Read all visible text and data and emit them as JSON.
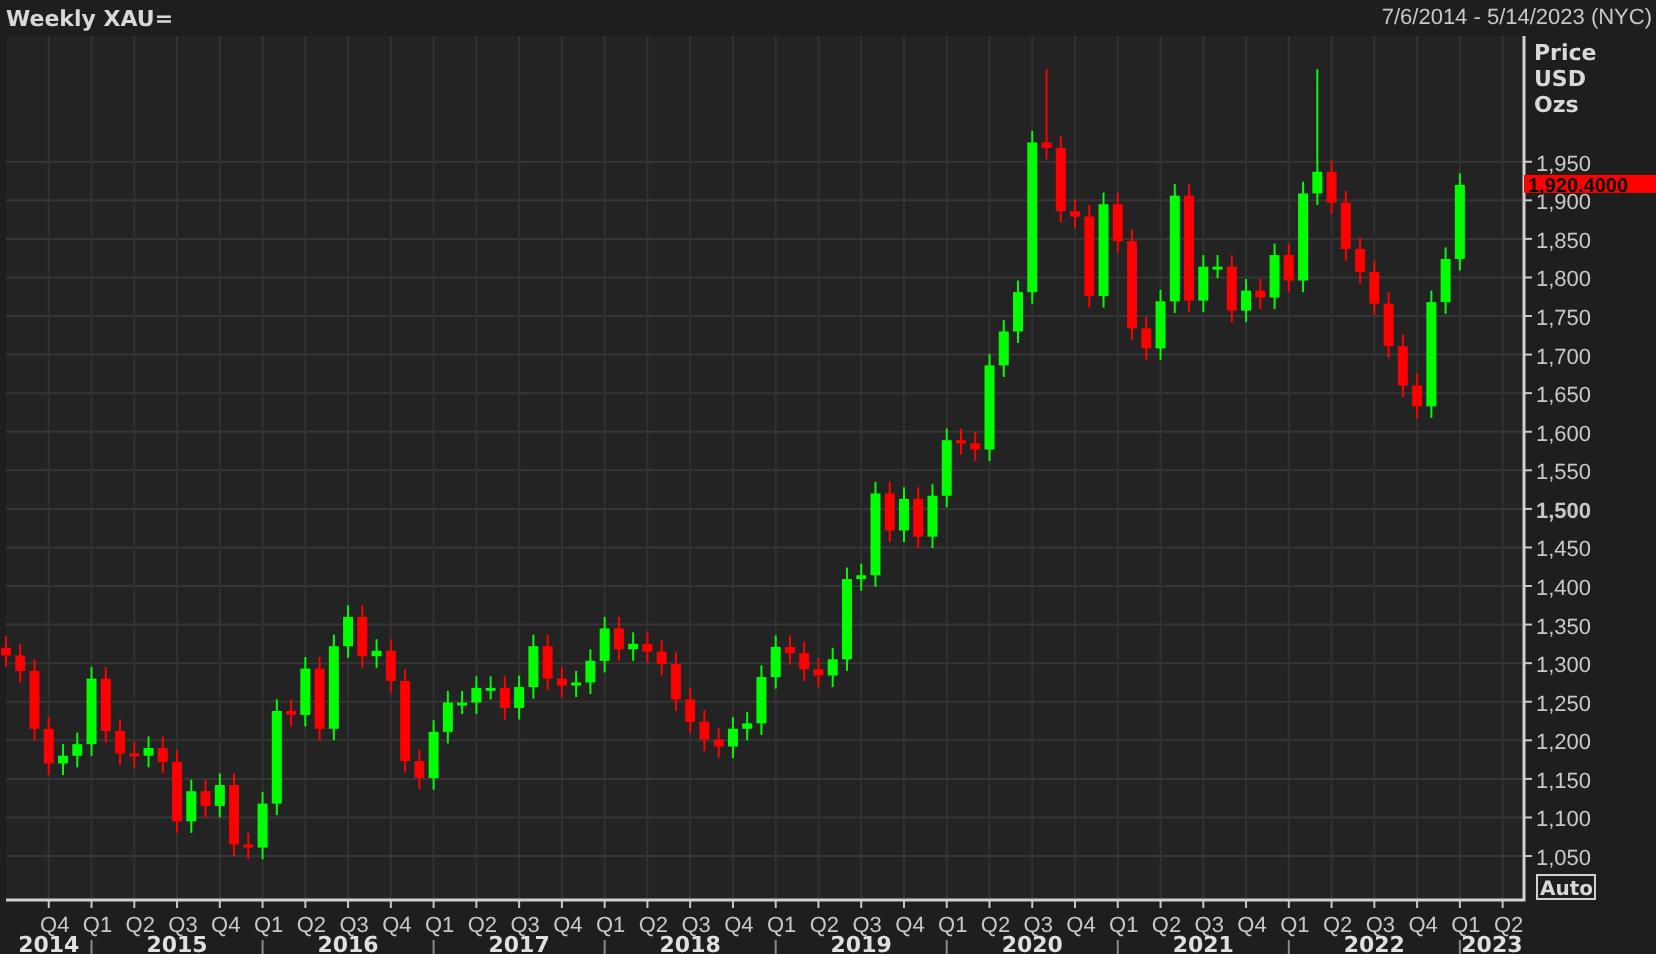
{
  "header": {
    "title": "Weekly XAU=",
    "date_range": "7/6/2014 - 5/14/2023 (NYC)"
  },
  "price_axis": {
    "heading": [
      "Price",
      "USD",
      "Ozs"
    ],
    "tick_bold": [
      false,
      false,
      false,
      false,
      false,
      false,
      false,
      false,
      false,
      true,
      false,
      false,
      false,
      false,
      false,
      false,
      false,
      false,
      false
    ],
    "last_price": "1,920.4000",
    "auto_button": "Auto"
  },
  "time_axis": {
    "years": [
      "2014",
      "2015",
      "2016",
      "2017",
      "2018",
      "2019",
      "2020",
      "2021",
      "2022",
      "2023"
    ]
  },
  "chart": {
    "chart_data": {
      "type": "candlestick",
      "grid": true,
      "ylim": [
        993,
        2113
      ],
      "categories": [
        null,
        null,
        null,
        "Q4",
        null,
        null,
        "Q1",
        null,
        null,
        "Q2",
        null,
        null,
        "Q3",
        null,
        null,
        "Q4",
        null,
        null,
        "Q1",
        null,
        null,
        "Q2",
        null,
        null,
        "Q3",
        null,
        null,
        "Q4",
        null,
        null,
        "Q1",
        null,
        null,
        "Q2",
        null,
        null,
        "Q3",
        null,
        null,
        "Q4",
        null,
        null,
        "Q1",
        null,
        null,
        "Q2",
        null,
        null,
        "Q3",
        null,
        null,
        "Q4",
        null,
        null,
        "Q1",
        null,
        null,
        "Q2",
        null,
        null,
        "Q3",
        null,
        null,
        "Q4",
        null,
        null,
        "Q1",
        null,
        null,
        "Q2",
        null,
        null,
        "Q3",
        null,
        null,
        "Q4",
        null,
        null,
        "Q1",
        null,
        null,
        "Q2",
        null,
        null,
        "Q3",
        null,
        null,
        "Q4",
        null,
        null,
        "Q1",
        null,
        null,
        "Q2",
        null,
        null,
        "Q3",
        null,
        null,
        "Q4",
        null,
        null,
        "Q1",
        null,
        null,
        "Q2",
        null
      ],
      "ohlc": [
        [
          1320,
          1335,
          1295,
          1310
        ],
        [
          1310,
          1325,
          1275,
          1290
        ],
        [
          1290,
          1305,
          1200,
          1215
        ],
        [
          1215,
          1230,
          1155,
          1170
        ],
        [
          1170,
          1195,
          1155,
          1180
        ],
        [
          1180,
          1210,
          1165,
          1195
        ],
        [
          1195,
          1295,
          1180,
          1280
        ],
        [
          1280,
          1295,
          1197,
          1212
        ],
        [
          1212,
          1227,
          1168,
          1183
        ],
        [
          1183,
          1198,
          1165,
          1180
        ],
        [
          1180,
          1205,
          1165,
          1190
        ],
        [
          1190,
          1205,
          1157,
          1172
        ],
        [
          1172,
          1187,
          1080,
          1095
        ],
        [
          1095,
          1149,
          1080,
          1134
        ],
        [
          1134,
          1149,
          1100,
          1115
        ],
        [
          1115,
          1157,
          1100,
          1142
        ],
        [
          1142,
          1157,
          1050,
          1065
        ],
        [
          1065,
          1080,
          1046,
          1061
        ],
        [
          1061,
          1133,
          1046,
          1118
        ],
        [
          1118,
          1253,
          1103,
          1238
        ],
        [
          1238,
          1253,
          1218,
          1233
        ],
        [
          1233,
          1308,
          1218,
          1293
        ],
        [
          1293,
          1308,
          1200,
          1215
        ],
        [
          1215,
          1337,
          1200,
          1322
        ],
        [
          1322,
          1375,
          1307,
          1360
        ],
        [
          1360,
          1375,
          1294,
          1309
        ],
        [
          1309,
          1331,
          1294,
          1316
        ],
        [
          1316,
          1331,
          1262,
          1277
        ],
        [
          1277,
          1292,
          1158,
          1173
        ],
        [
          1173,
          1188,
          1136,
          1151
        ],
        [
          1151,
          1226,
          1136,
          1211
        ],
        [
          1211,
          1264,
          1196,
          1249
        ],
        [
          1249,
          1264,
          1234,
          1249
        ],
        [
          1249,
          1283,
          1234,
          1268
        ],
        [
          1268,
          1283,
          1253,
          1268
        ],
        [
          1268,
          1283,
          1227,
          1242
        ],
        [
          1242,
          1284,
          1227,
          1269
        ],
        [
          1269,
          1337,
          1254,
          1322
        ],
        [
          1322,
          1337,
          1265,
          1280
        ],
        [
          1280,
          1295,
          1256,
          1271
        ],
        [
          1271,
          1290,
          1256,
          1275
        ],
        [
          1275,
          1318,
          1260,
          1303
        ],
        [
          1303,
          1360,
          1288,
          1345
        ],
        [
          1345,
          1360,
          1303,
          1318
        ],
        [
          1318,
          1340,
          1303,
          1325
        ],
        [
          1325,
          1340,
          1300,
          1315
        ],
        [
          1315,
          1330,
          1284,
          1299
        ],
        [
          1299,
          1314,
          1238,
          1253
        ],
        [
          1253,
          1268,
          1209,
          1224
        ],
        [
          1224,
          1239,
          1186,
          1201
        ],
        [
          1201,
          1216,
          1177,
          1192
        ],
        [
          1192,
          1230,
          1177,
          1215
        ],
        [
          1215,
          1237,
          1200,
          1222
        ],
        [
          1222,
          1297,
          1207,
          1282
        ],
        [
          1282,
          1336,
          1267,
          1321
        ],
        [
          1321,
          1336,
          1298,
          1313
        ],
        [
          1313,
          1328,
          1277,
          1292
        ],
        [
          1292,
          1307,
          1269,
          1284
        ],
        [
          1284,
          1320,
          1269,
          1305
        ],
        [
          1305,
          1424,
          1290,
          1409
        ],
        [
          1409,
          1429,
          1394,
          1414
        ],
        [
          1414,
          1535,
          1399,
          1520
        ],
        [
          1520,
          1535,
          1457,
          1472
        ],
        [
          1472,
          1528,
          1457,
          1513
        ],
        [
          1513,
          1528,
          1449,
          1464
        ],
        [
          1464,
          1532,
          1449,
          1517
        ],
        [
          1517,
          1604,
          1502,
          1589
        ],
        [
          1589,
          1604,
          1570,
          1585
        ],
        [
          1585,
          1600,
          1562,
          1577
        ],
        [
          1577,
          1701,
          1562,
          1686
        ],
        [
          1686,
          1745,
          1671,
          1730
        ],
        [
          1730,
          1796,
          1715,
          1781
        ],
        [
          1781,
          1990,
          1766,
          1975
        ],
        [
          1975,
          2070,
          1953,
          1968
        ],
        [
          1968,
          1983,
          1871,
          1886
        ],
        [
          1886,
          1901,
          1864,
          1879
        ],
        [
          1879,
          1894,
          1761,
          1776
        ],
        [
          1776,
          1910,
          1761,
          1895
        ],
        [
          1895,
          1910,
          1832,
          1847
        ],
        [
          1847,
          1862,
          1719,
          1734
        ],
        [
          1734,
          1749,
          1693,
          1708
        ],
        [
          1708,
          1784,
          1693,
          1769
        ],
        [
          1769,
          1921,
          1754,
          1906
        ],
        [
          1906,
          1921,
          1755,
          1770
        ],
        [
          1770,
          1829,
          1755,
          1814
        ],
        [
          1814,
          1829,
          1799,
          1814
        ],
        [
          1814,
          1829,
          1742,
          1757
        ],
        [
          1757,
          1798,
          1742,
          1783
        ],
        [
          1783,
          1798,
          1759,
          1774
        ],
        [
          1774,
          1844,
          1759,
          1829
        ],
        [
          1829,
          1844,
          1781,
          1796
        ],
        [
          1796,
          1924,
          1781,
          1909
        ],
        [
          1909,
          2070,
          1894,
          1937
        ],
        [
          1937,
          1952,
          1882,
          1897
        ],
        [
          1897,
          1912,
          1822,
          1837
        ],
        [
          1837,
          1852,
          1792,
          1807
        ],
        [
          1807,
          1822,
          1751,
          1766
        ],
        [
          1766,
          1781,
          1696,
          1711
        ],
        [
          1711,
          1726,
          1645,
          1660
        ],
        [
          1660,
          1675,
          1618,
          1633
        ],
        [
          1633,
          1783,
          1618,
          1768
        ],
        [
          1768,
          1839,
          1753,
          1824
        ],
        [
          1824,
          1935,
          1809,
          1920
        ],
        null,
        null,
        null,
        null
      ],
      "yticks": [
        {
          "value": 1050,
          "label": "1,050"
        },
        {
          "value": 1100,
          "label": "1,100"
        },
        {
          "value": 1150,
          "label": "1,150"
        },
        {
          "value": 1200,
          "label": "1,200"
        },
        {
          "value": 1250,
          "label": "1,250"
        },
        {
          "value": 1300,
          "label": "1,300"
        },
        {
          "value": 1350,
          "label": "1,350"
        },
        {
          "value": 1400,
          "label": "1,400"
        },
        {
          "value": 1450,
          "label": "1,450"
        },
        {
          "value": 1500,
          "label": "1,500"
        },
        {
          "value": 1550,
          "label": "1,550"
        },
        {
          "value": 1600,
          "label": "1,600"
        },
        {
          "value": 1650,
          "label": "1,650"
        },
        {
          "value": 1700,
          "label": "1,700"
        },
        {
          "value": 1750,
          "label": "1,750"
        },
        {
          "value": 1800,
          "label": "1,800"
        },
        {
          "value": 1850,
          "label": "1,850"
        },
        {
          "value": 1900,
          "label": "1,900"
        },
        {
          "value": 1950,
          "label": "1,950"
        }
      ]
    }
  }
}
